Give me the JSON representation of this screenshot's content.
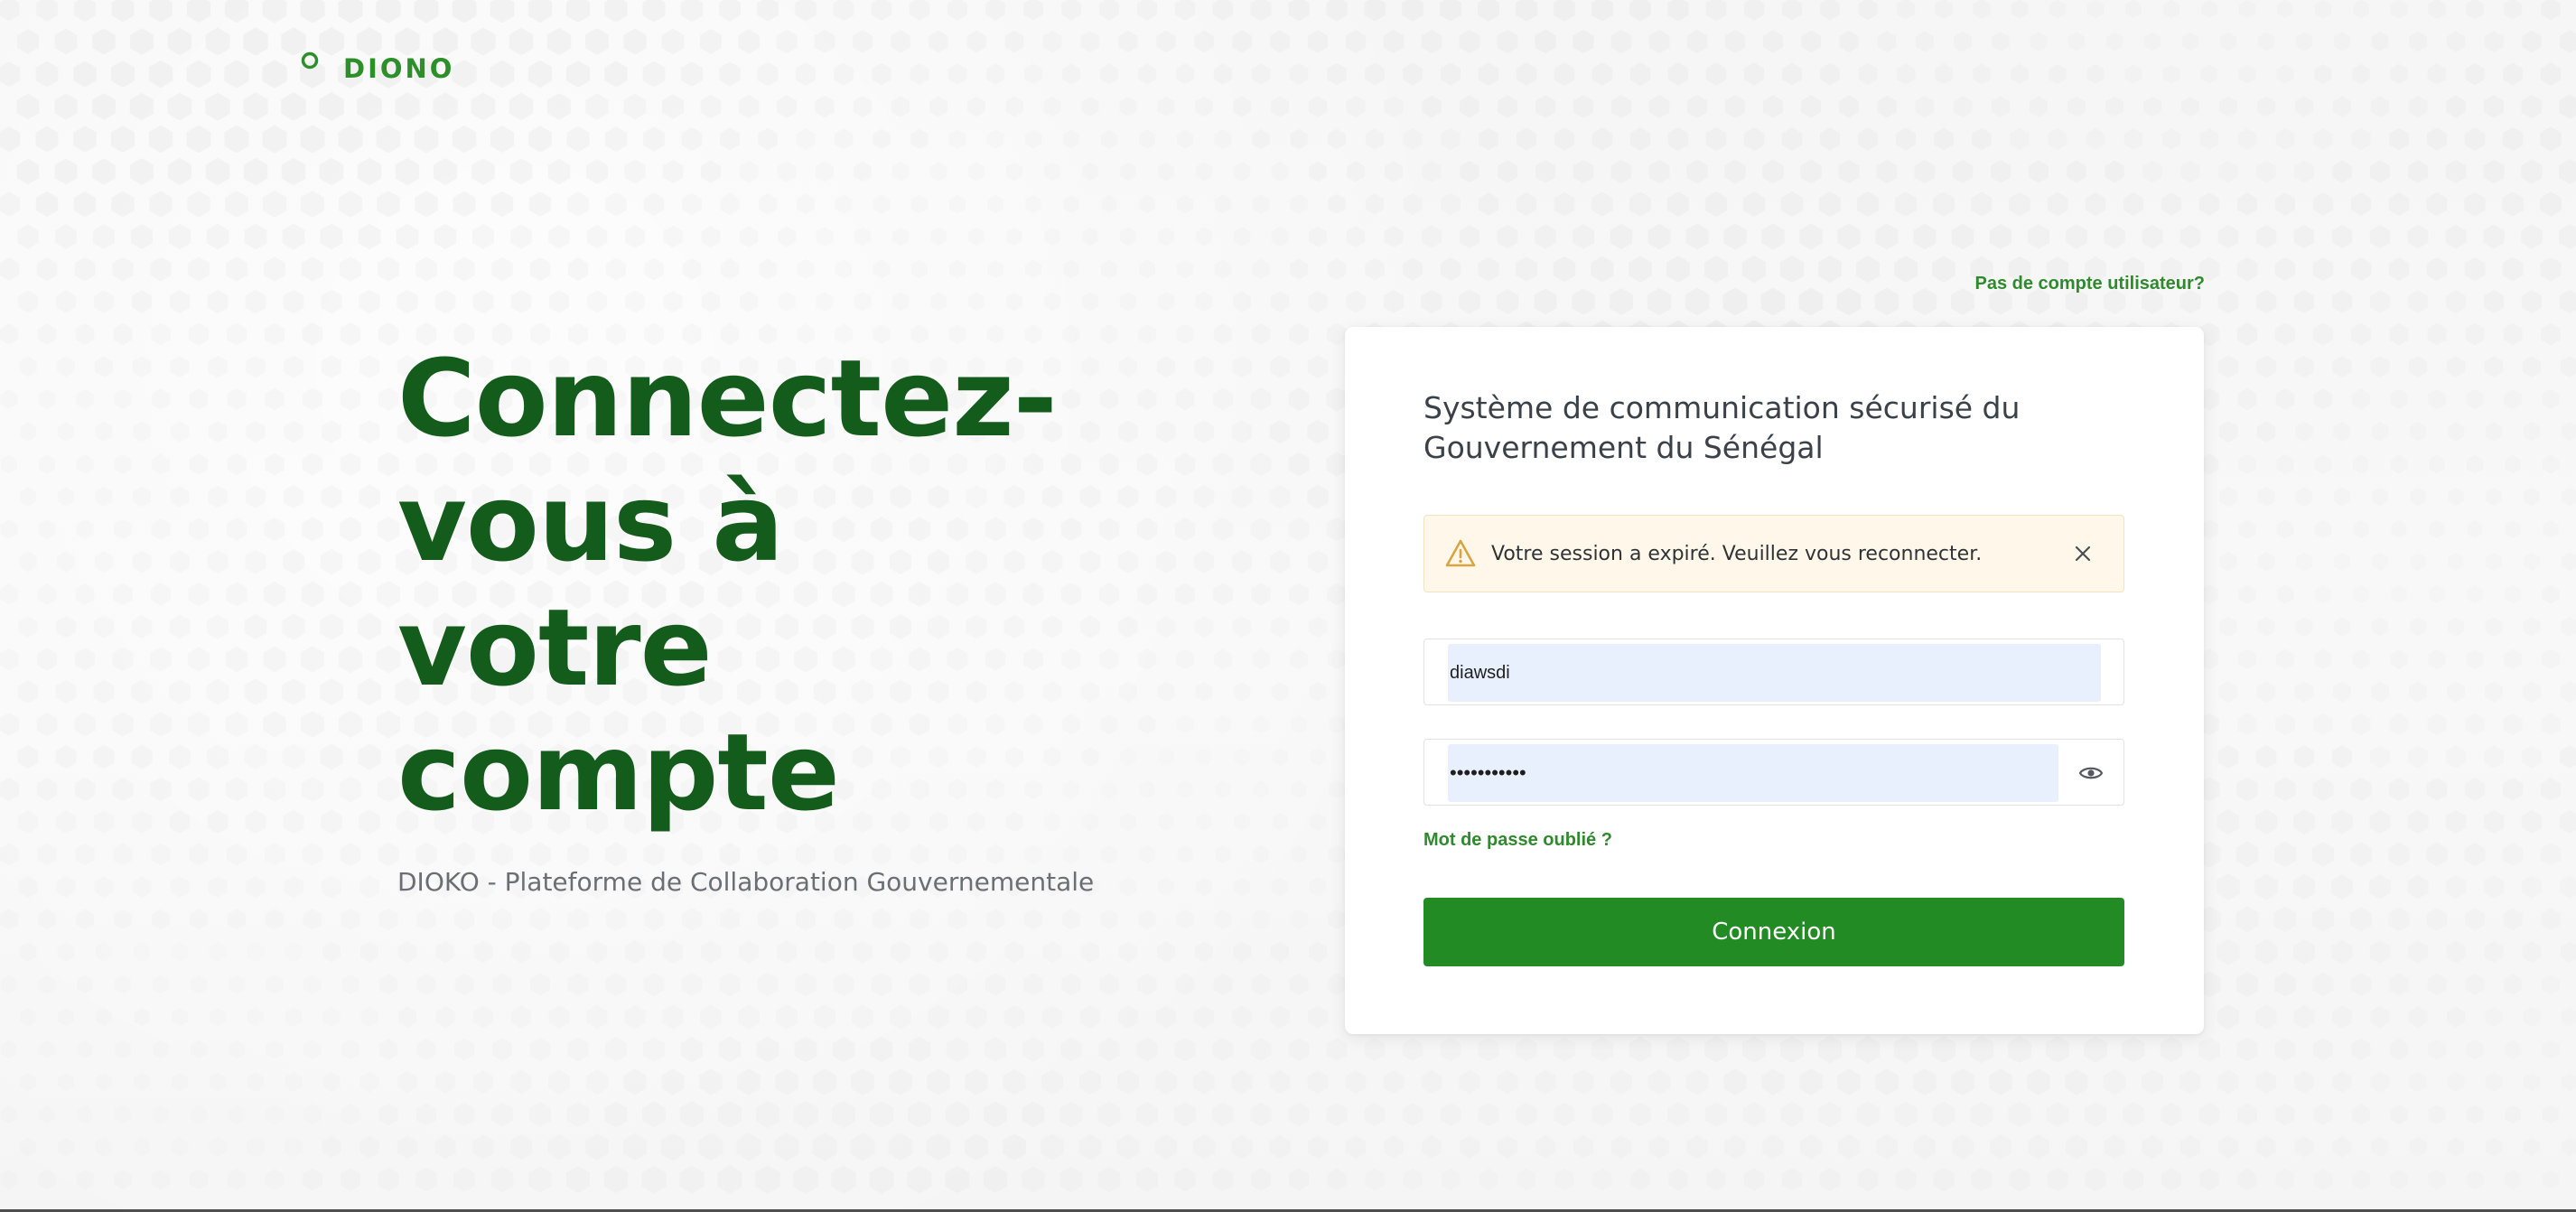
{
  "brand": {
    "name": "DIONO",
    "icon": "brand-circle-icon"
  },
  "header": {
    "signup_link": "Pas de compte utilisateur?"
  },
  "hero": {
    "title": "Connectez-vous à votre compte",
    "subtitle": "DIOKO - Plateforme de Collaboration Gouvernementale"
  },
  "login_card": {
    "title": "Système de communication sécurisé du Gouvernement du Sénégal",
    "alert": {
      "icon": "warning-triangle-icon",
      "message": "Votre session a expiré. Veuillez vous reconnecter.",
      "close_icon": "close-icon"
    },
    "username": {
      "value": "diawsdi"
    },
    "password": {
      "value": "•••••••••••",
      "toggle_icon": "eye-icon"
    },
    "forgot_password": "Mot de passe oublié ?",
    "submit": "Connexion"
  },
  "colors": {
    "brand_green": "#2c8f2a",
    "hero_green": "#145c1b",
    "button_green": "#238b24",
    "alert_background": "#fff8ea",
    "alert_icon": "#d9a441",
    "autofill_blue": "#e8f0fe"
  }
}
